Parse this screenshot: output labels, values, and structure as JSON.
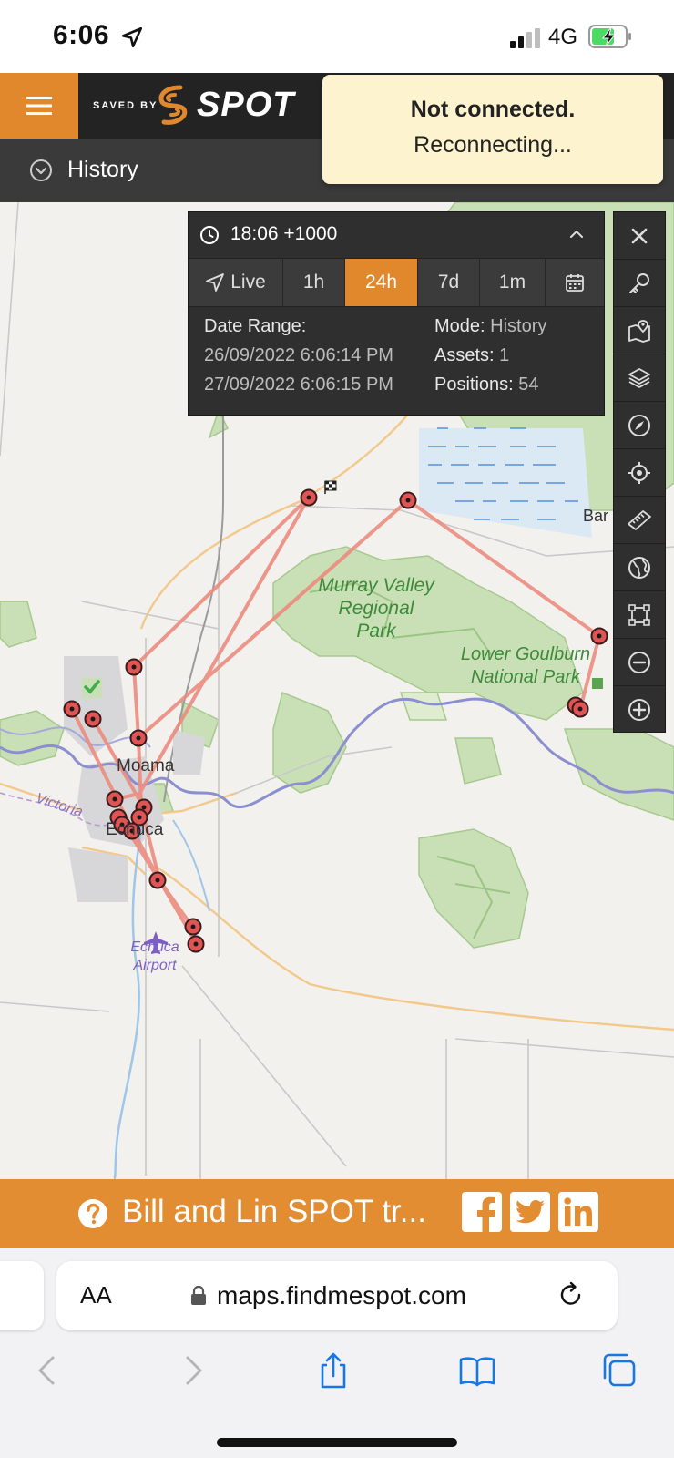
{
  "status_bar": {
    "time": "6:06",
    "network": "4G"
  },
  "header": {
    "logo_saved_by": "SAVED BY",
    "logo_brand": "SPOT"
  },
  "subheader": {
    "title": "History"
  },
  "toast": {
    "title": "Not connected.",
    "message": "Reconnecting..."
  },
  "panel": {
    "time": "18:06 +1000",
    "tabs": [
      {
        "label": "Live",
        "active": false
      },
      {
        "label": "1h",
        "active": false
      },
      {
        "label": "24h",
        "active": true
      },
      {
        "label": "7d",
        "active": false
      },
      {
        "label": "1m",
        "active": false
      }
    ],
    "date_range_label": "Date Range:",
    "date_from": "26/09/2022 6:06:14 PM",
    "date_to": "27/09/2022 6:06:15 PM",
    "mode_label": "Mode:",
    "mode_value": "History",
    "assets_label": "Assets:",
    "assets_value": "1",
    "positions_label": "Positions:",
    "positions_value": "54"
  },
  "map": {
    "labels": {
      "murray": "Murray Valley Regional Park",
      "goulburn": "Lower Goulburn National Park",
      "moama": "Moama",
      "echuca": "Echuca",
      "victoria": "Victoria",
      "airport": "Echuca Airport",
      "barmah": "Bar"
    },
    "track_color": "#ec8c80",
    "accent_color": "#e2882c"
  },
  "toolbar": {
    "icons": [
      "close-icon",
      "key-icon",
      "map-marker-icon",
      "layers-icon",
      "compass-icon",
      "crosshair-icon",
      "ruler-icon",
      "globe-icon",
      "select-area-icon",
      "zoom-out-icon",
      "zoom-in-icon"
    ]
  },
  "footer": {
    "title": "Bill and Lin SPOT tr..."
  },
  "browser": {
    "text_size": "AA",
    "url": "maps.findmespot.com"
  }
}
